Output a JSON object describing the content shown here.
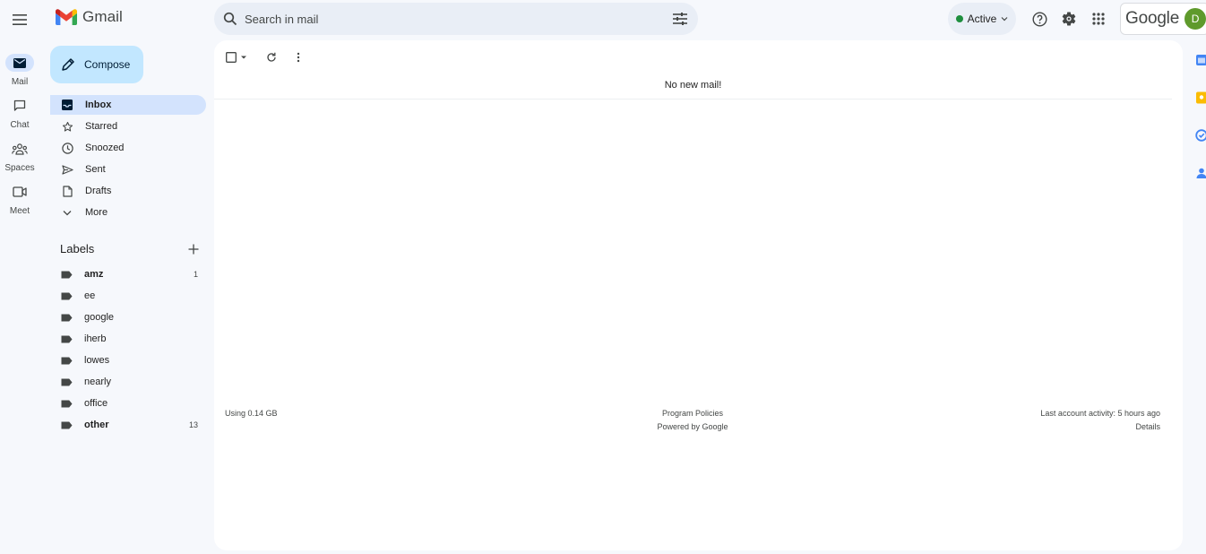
{
  "header": {
    "app_name": "Gmail",
    "search_placeholder": "Search in mail",
    "status_label": "Active",
    "google_word": "Google",
    "avatar_initial": "D"
  },
  "rail": [
    {
      "label": "Mail",
      "icon": "mail-icon"
    },
    {
      "label": "Chat",
      "icon": "chat-icon"
    },
    {
      "label": "Spaces",
      "icon": "spaces-icon"
    },
    {
      "label": "Meet",
      "icon": "meet-icon"
    }
  ],
  "compose_label": "Compose",
  "nav": {
    "inbox": "Inbox",
    "starred": "Starred",
    "snoozed": "Snoozed",
    "sent": "Sent",
    "drafts": "Drafts",
    "more": "More"
  },
  "labels": {
    "heading": "Labels",
    "items": [
      {
        "name": "amz",
        "count": "1"
      },
      {
        "name": "ee",
        "count": ""
      },
      {
        "name": "google",
        "count": ""
      },
      {
        "name": "iherb",
        "count": ""
      },
      {
        "name": "lowes",
        "count": ""
      },
      {
        "name": "nearly",
        "count": ""
      },
      {
        "name": "office",
        "count": ""
      },
      {
        "name": "other",
        "count": "13"
      }
    ]
  },
  "main": {
    "empty_message": "No new mail!",
    "storage": "Using 0.14 GB",
    "program_policies": "Program Policies",
    "powered_by": "Powered by Google",
    "last_activity": "Last account activity: 5 hours ago",
    "details": "Details"
  },
  "colors": {
    "accent": "#0b57d0",
    "compose_bg": "#c2e7ff",
    "active_nav": "#d3e3fd",
    "status_green": "#1e8e3e",
    "avatar_bg": "#5f9a2c"
  }
}
